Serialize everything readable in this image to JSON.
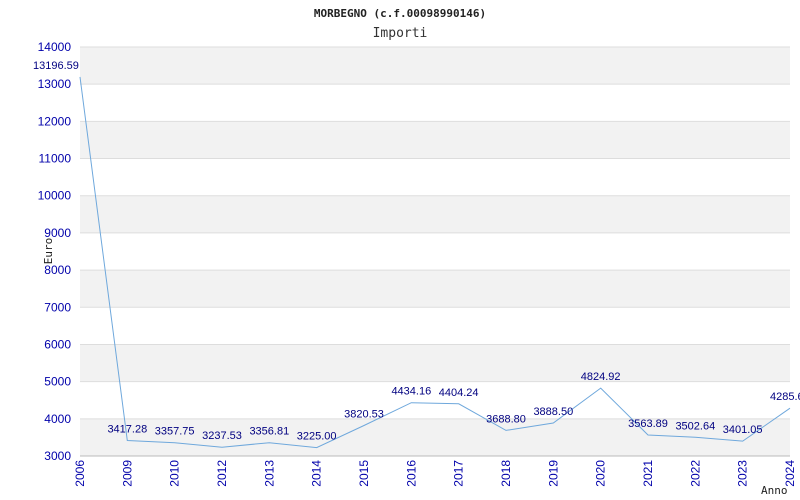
{
  "chart_data": {
    "type": "line",
    "title": "MORBEGNO (c.f.00098990146)",
    "subtitle": "Importi",
    "xlabel": "Anno",
    "ylabel": "Euro",
    "ylim": [
      3000,
      14000
    ],
    "yticks": [
      3000,
      4000,
      5000,
      6000,
      7000,
      8000,
      9000,
      10000,
      11000,
      12000,
      13000,
      14000
    ],
    "grid": true,
    "categories": [
      "2006",
      "2009",
      "2010",
      "2012",
      "2013",
      "2014",
      "2015",
      "2016",
      "2017",
      "2018",
      "2019",
      "2020",
      "2021",
      "2022",
      "2023",
      "2024"
    ],
    "values": [
      13196.59,
      3417.28,
      3357.75,
      3237.53,
      3356.81,
      3225.0,
      3820.53,
      4434.16,
      4404.24,
      3688.8,
      3888.5,
      4824.92,
      3563.89,
      3502.64,
      3401.05,
      4285.6
    ],
    "data_labels": [
      "13196.59",
      "3417.28",
      "3357.75",
      "3237.53",
      "3356.81",
      "3225.00",
      "3820.53",
      "4434.16",
      "4404.24",
      "3688.80",
      "3888.50",
      "4824.92",
      "3563.89",
      "3502.64",
      "3401.05",
      "4285.6"
    ],
    "colors": {
      "line": "#6fa8dc",
      "tick_text": "#0000aa",
      "label_text": "#000080",
      "band": "#f2f2f2",
      "grid": "#dddddd"
    }
  }
}
